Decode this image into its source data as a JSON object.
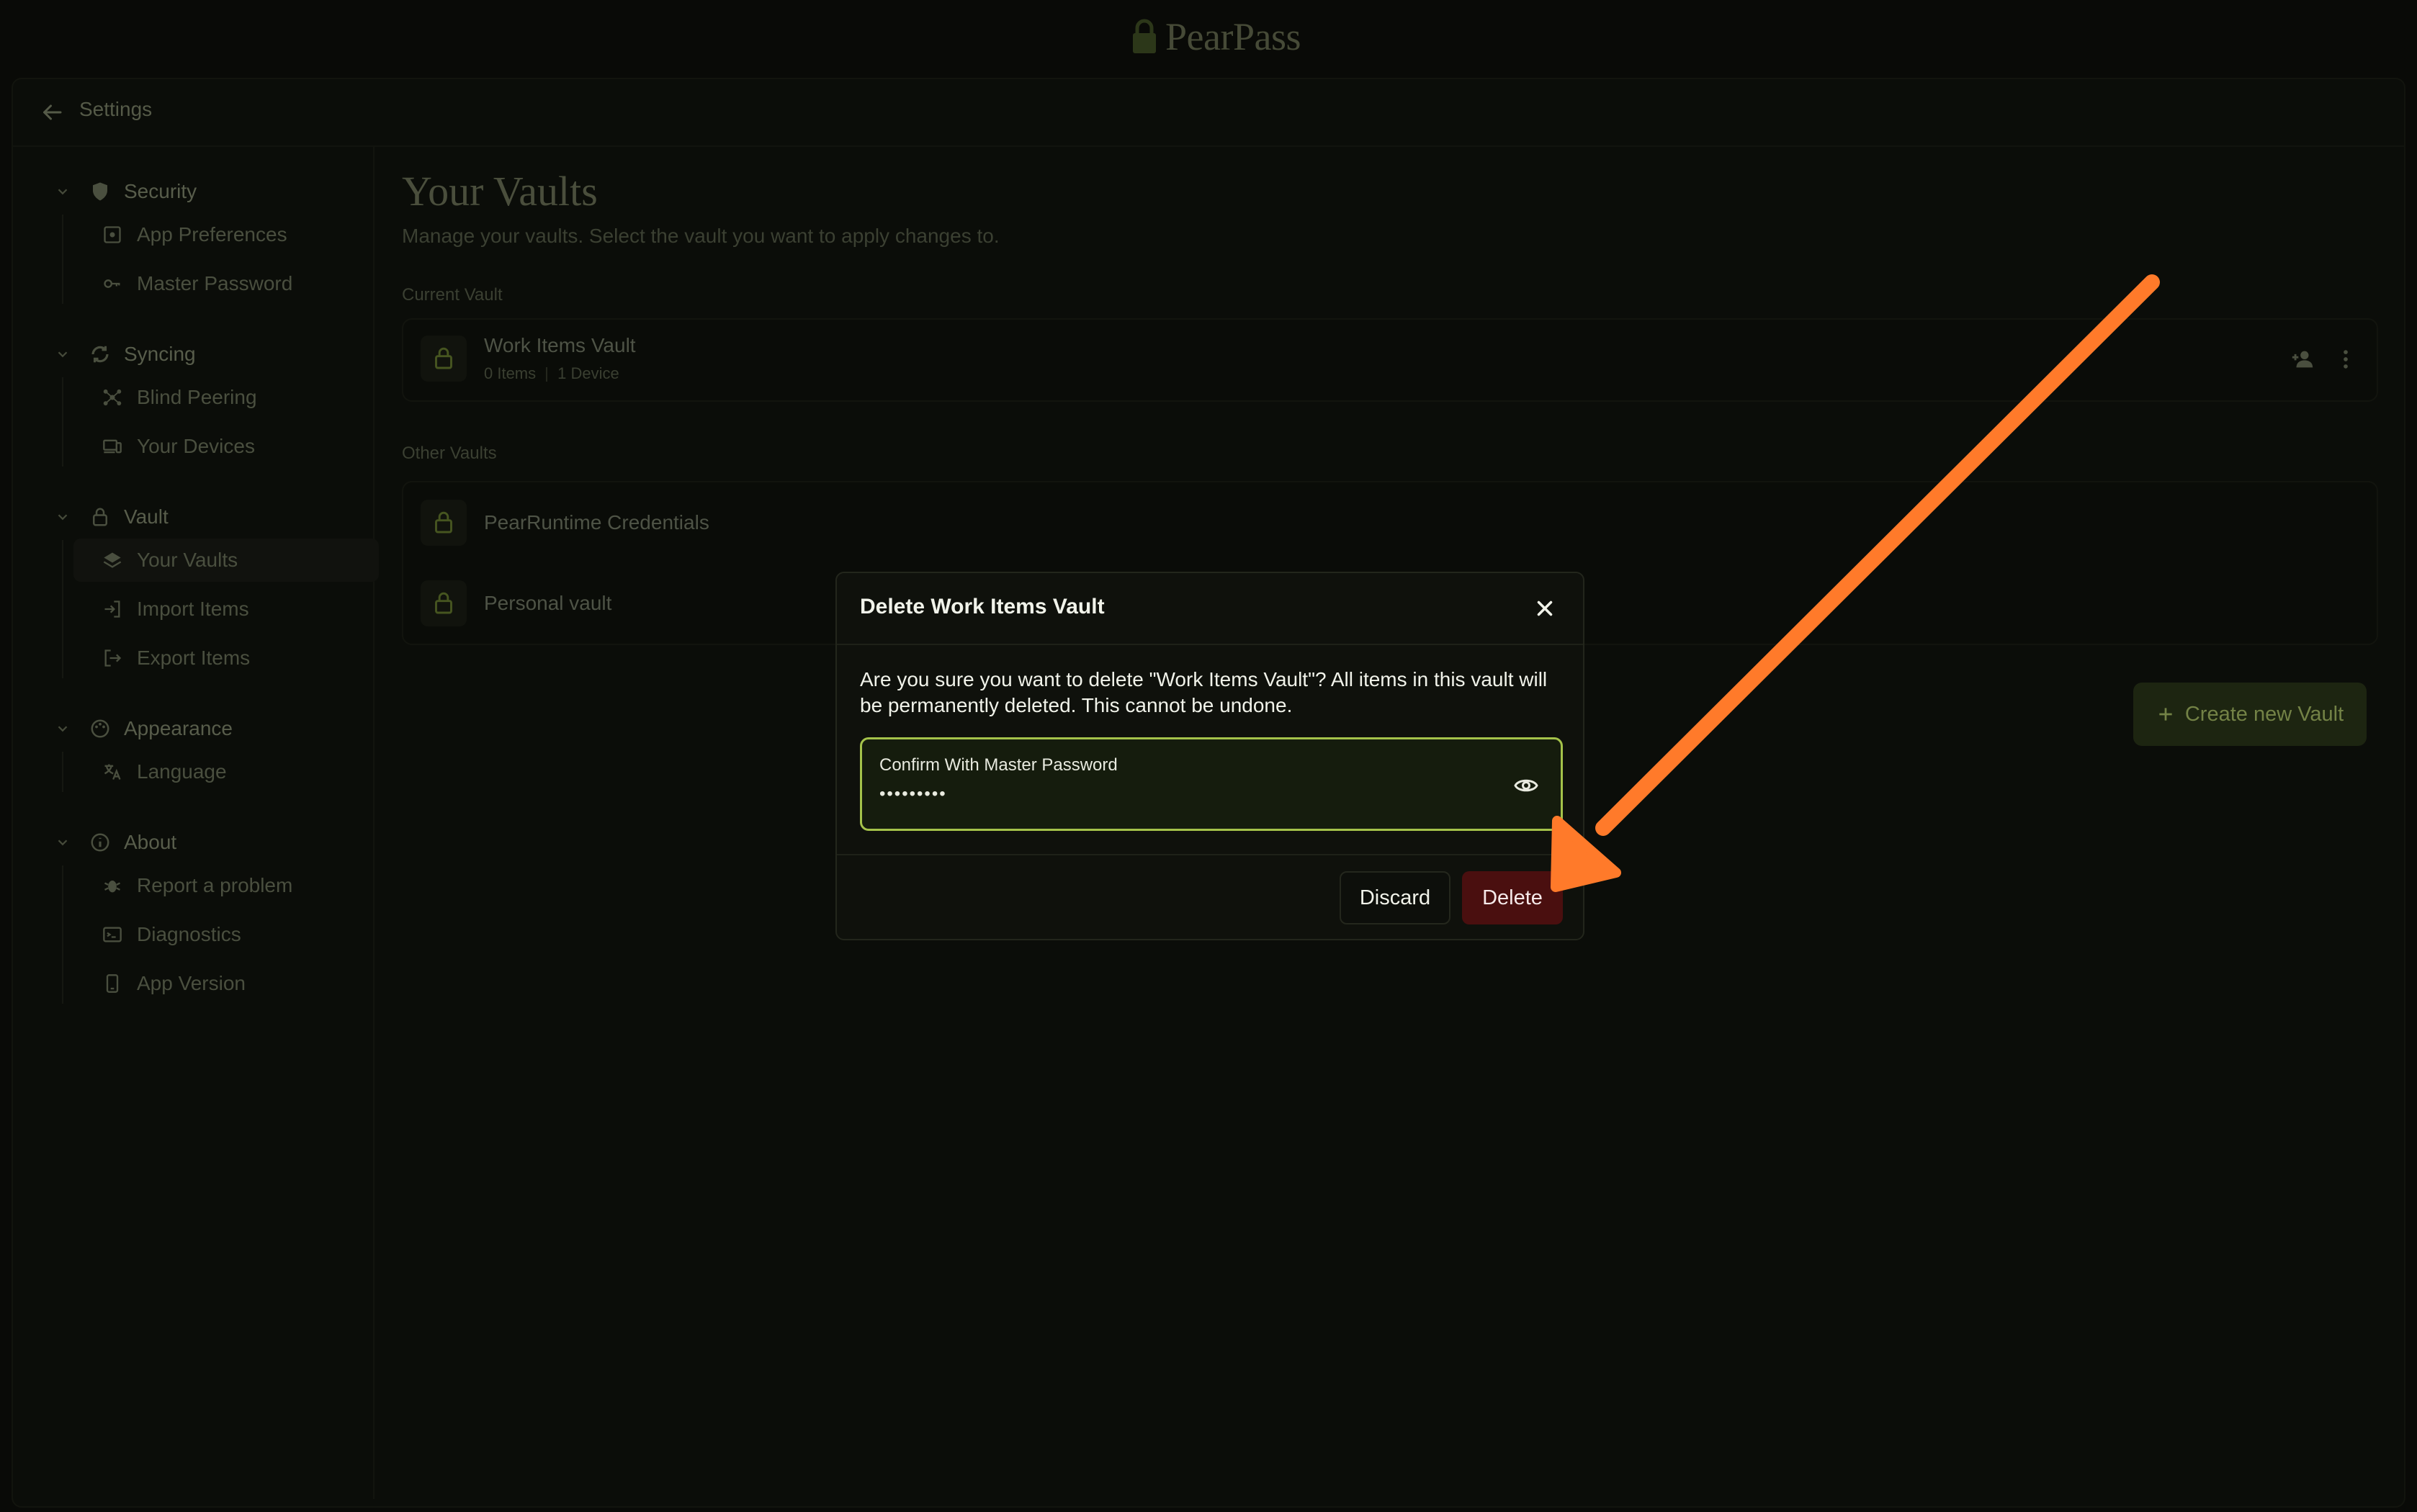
{
  "app": {
    "brand": "PearPass"
  },
  "header": {
    "title": "Settings"
  },
  "sidebar": {
    "sections": [
      {
        "label": "Security",
        "icon": "shield-icon",
        "items": [
          {
            "label": "App Preferences",
            "icon": "preferences-icon"
          },
          {
            "label": "Master Password",
            "icon": "key-icon"
          }
        ]
      },
      {
        "label": "Syncing",
        "icon": "sync-icon",
        "items": [
          {
            "label": "Blind Peering",
            "icon": "peering-icon"
          },
          {
            "label": "Your Devices",
            "icon": "devices-icon"
          }
        ]
      },
      {
        "label": "Vault",
        "icon": "lock-icon",
        "items": [
          {
            "label": "Your Vaults",
            "icon": "layers-icon",
            "active": true
          },
          {
            "label": "Import Items",
            "icon": "import-icon"
          },
          {
            "label": "Export Items",
            "icon": "export-icon"
          }
        ]
      },
      {
        "label": "Appearance",
        "icon": "palette-icon",
        "items": [
          {
            "label": "Language",
            "icon": "translate-icon"
          }
        ]
      },
      {
        "label": "About",
        "icon": "info-icon",
        "items": [
          {
            "label": "Report a problem",
            "icon": "bug-icon"
          },
          {
            "label": "Diagnostics",
            "icon": "terminal-icon"
          },
          {
            "label": "App Version",
            "icon": "phone-icon"
          }
        ]
      }
    ]
  },
  "main": {
    "title": "Your Vaults",
    "subtitle": "Manage your vaults. Select the vault you want to apply changes to.",
    "current_label": "Current Vault",
    "current_vault": {
      "name": "Work Items Vault",
      "items": "0 Items",
      "devices": "1 Device"
    },
    "other_label": "Other Vaults",
    "other_vaults": [
      {
        "name": "PearRuntime Credentials"
      },
      {
        "name": "Personal vault"
      }
    ],
    "create_button": "Create new Vault"
  },
  "modal": {
    "title": "Delete Work Items Vault",
    "message": "Are you sure you want to delete \"Work Items Vault\"? All items in this vault will be permanently deleted. This cannot be undone.",
    "password_label": "Confirm With Master Password",
    "password_value": "•••••••••",
    "discard_label": "Discard",
    "delete_label": "Delete"
  },
  "colors": {
    "accent": "#a4c24a",
    "danger": "#4a0f0f",
    "annotation": "#ff7a2a",
    "background": "#0a0b08"
  }
}
